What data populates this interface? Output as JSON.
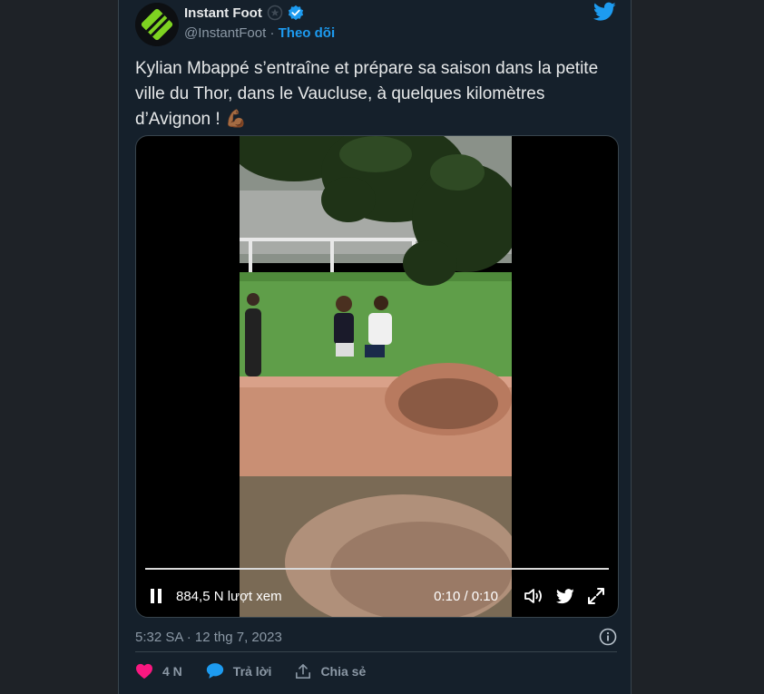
{
  "tweet": {
    "display_name": "Instant Foot",
    "handle": "@InstantFoot",
    "separator": " · ",
    "follow_label": "Theo dõi",
    "text": "Kylian Mbappé s’entraîne et prépare sa saison dans la petite ville du Thor, dans le Vaucluse, à quelques kilomètres d’Avignon ! 💪🏾",
    "timestamp": "5:32 SA · 12 thg 7, 2023"
  },
  "video": {
    "views": "884,5 N lượt xem",
    "time": "0:10 / 0:10",
    "progress": 1.0
  },
  "actions": {
    "like_count": "4 N",
    "reply_label": "Trả lời",
    "share_label": "Chia sẻ"
  },
  "colors": {
    "accent": "#1d9bf0",
    "like": "#f91880",
    "background": "#15202b",
    "logo_green": "#7ed321"
  },
  "icons": [
    "instant-foot-logo",
    "verified-badge-icon",
    "twitter-bird-icon",
    "pause-icon",
    "volume-icon",
    "twitter-logo-icon",
    "fullscreen-icon",
    "info-icon",
    "heart-icon",
    "reply-icon",
    "share-icon"
  ]
}
